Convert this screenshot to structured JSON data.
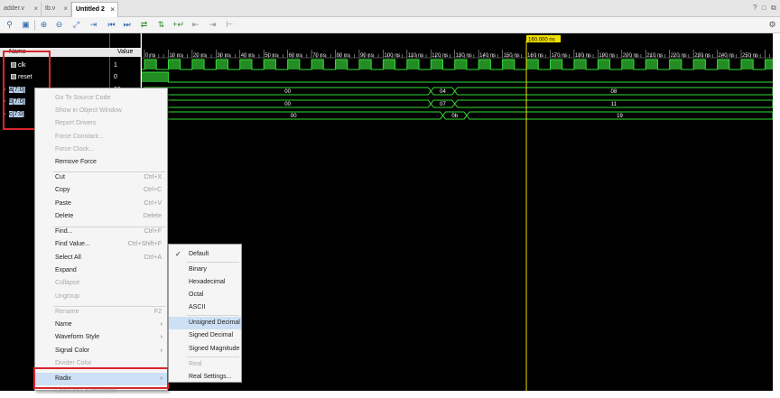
{
  "tabs": [
    {
      "label": "adder.v"
    },
    {
      "label": "tb.v"
    },
    {
      "label": "Untitled 2"
    }
  ],
  "window_controls": [
    "?",
    "□",
    "⧉"
  ],
  "toolbar": {
    "buttons": [
      "search-icon",
      "save-icon",
      "zoom-in-icon",
      "zoom-out-icon",
      "zoom-fit-icon",
      "add-marker-icon",
      "go-first-icon",
      "go-last-icon",
      "swap-icon",
      "swap2-icon",
      "add-cursor-icon",
      "prev-transition-icon",
      "next-transition-icon",
      "snap-icon"
    ],
    "settings_icon": "gear-icon"
  },
  "columns": {
    "name": "Name",
    "value": "Value"
  },
  "signals": [
    {
      "name": "clk",
      "value": "1"
    },
    {
      "name": "reset",
      "value": "0"
    },
    {
      "name": "a[7:0]",
      "value": "08"
    },
    {
      "name": "b[7:0]",
      "value": "11"
    },
    {
      "name": "c[7:0]",
      "value": "19"
    }
  ],
  "waveform": {
    "cursor_label": "160.000 ns",
    "time_unit": "ns",
    "ticks": [
      "0 ns",
      "10 ns",
      "20 ns",
      "30 ns",
      "40 ns",
      "50 ns",
      "60 ns",
      "70 ns",
      "80 ns",
      "90 ns",
      "100 ns",
      "110 ns",
      "120 ns",
      "130 ns",
      "140 ns",
      "150 ns",
      "160 ns",
      "170 ns",
      "180 ns",
      "190 ns",
      "200 ns",
      "210 ns",
      "220 ns",
      "230 ns",
      "240 ns",
      "250 ns"
    ],
    "bus_a": [
      "00",
      "04",
      "08"
    ],
    "bus_b": [
      "00",
      "07",
      "11"
    ],
    "bus_c": [
      "00",
      "0b",
      "19"
    ]
  },
  "context_menu": {
    "items": [
      {
        "label": "Go To Source Code",
        "shortcut": "",
        "disabled": true
      },
      {
        "label": "Show in Object Window",
        "shortcut": "",
        "disabled": true
      },
      {
        "label": "Report Drivers",
        "shortcut": "",
        "disabled": true
      },
      {
        "label": "Force Constant...",
        "shortcut": "",
        "disabled": true
      },
      {
        "label": "Force Clock...",
        "shortcut": "",
        "disabled": true
      },
      {
        "label": "Remove Force",
        "shortcut": "",
        "disabled": false
      },
      {
        "label": "Cut",
        "shortcut": "Ctrl+X",
        "disabled": false
      },
      {
        "label": "Copy",
        "shortcut": "Ctrl+C",
        "disabled": false
      },
      {
        "label": "Paste",
        "shortcut": "Ctrl+V",
        "disabled": false
      },
      {
        "label": "Delete",
        "shortcut": "Delete",
        "disabled": false
      },
      {
        "label": "Find...",
        "shortcut": "Ctrl+F",
        "disabled": false
      },
      {
        "label": "Find Value...",
        "shortcut": "Ctrl+Shift+F",
        "disabled": false
      },
      {
        "label": "Select All",
        "shortcut": "Ctrl+A",
        "disabled": false
      },
      {
        "label": "Expand",
        "shortcut": "",
        "disabled": false
      },
      {
        "label": "Collapse",
        "shortcut": "",
        "disabled": true
      },
      {
        "label": "Ungroup",
        "shortcut": "",
        "disabled": true
      },
      {
        "label": "Rename",
        "shortcut": "F2",
        "disabled": true
      },
      {
        "label": "Name",
        "shortcut": "",
        "disabled": false
      },
      {
        "label": "Waveform Style",
        "shortcut": "",
        "disabled": false
      },
      {
        "label": "Signal Color",
        "shortcut": "",
        "disabled": false
      },
      {
        "label": "Divider Color",
        "shortcut": "",
        "disabled": true
      },
      {
        "label": "Radix",
        "shortcut": "",
        "disabled": false
      },
      {
        "label": "Show as Enumeration",
        "shortcut": "",
        "disabled": true
      }
    ]
  },
  "radix_menu": {
    "items": [
      {
        "label": "Default",
        "checked": true,
        "disabled": false
      },
      {
        "label": "Binary",
        "checked": false,
        "disabled": false
      },
      {
        "label": "Hexadecimal",
        "checked": false,
        "disabled": false
      },
      {
        "label": "Octal",
        "checked": false,
        "disabled": false
      },
      {
        "label": "ASCII",
        "checked": false,
        "disabled": false
      },
      {
        "label": "Unsigned Decimal",
        "checked": false,
        "disabled": false
      },
      {
        "label": "Signed Decimal",
        "checked": false,
        "disabled": false
      },
      {
        "label": "Signed Magnitude",
        "checked": false,
        "disabled": false
      },
      {
        "label": "Real",
        "checked": false,
        "disabled": true
      },
      {
        "label": "Real Settings...",
        "checked": false,
        "disabled": false
      }
    ]
  },
  "colors": {
    "wave": "#33dd33",
    "cursor": "#f0e000",
    "highlight_box": "#d9262c"
  }
}
